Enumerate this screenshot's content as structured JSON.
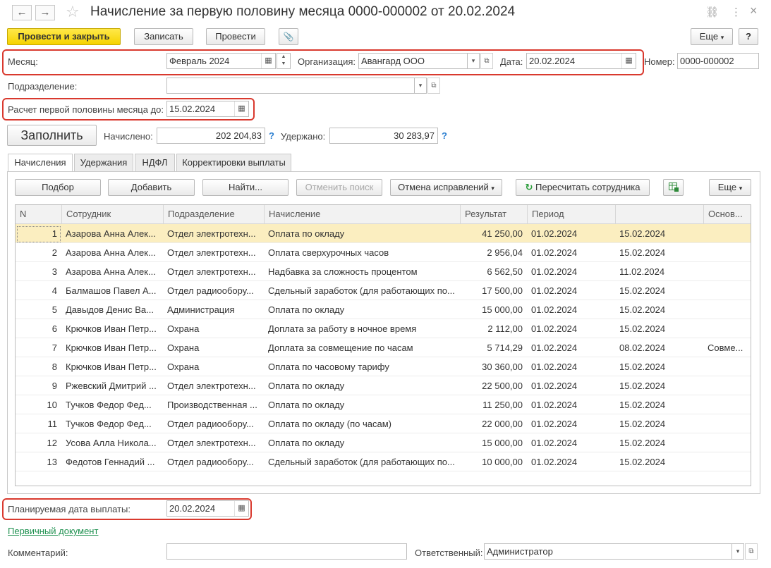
{
  "window": {
    "title": "Начисление за первую половину месяца 0000-000002 от 20.02.2024",
    "back_glyph": "←",
    "forward_glyph": "→",
    "star_glyph": "☆",
    "link_glyph": "⛓",
    "more_glyph": "⋮",
    "close_glyph": "×"
  },
  "toolbar": {
    "post_and_close": "Провести и закрыть",
    "save": "Записать",
    "post": "Провести",
    "attach_glyph": "📎",
    "more": "Еще",
    "help": "?"
  },
  "header": {
    "month_label": "Месяц:",
    "month_value": "Февраль 2024",
    "org_label": "Организация:",
    "org_value": "Авангард ООО",
    "date_label": "Дата:",
    "date_value": "20.02.2024",
    "number_label": "Номер:",
    "number_value": "0000-000002",
    "subdivision_label": "Подразделение:",
    "subdivision_value": "",
    "first_half_label": "Расчет первой половины месяца до:",
    "first_half_value": "15.02.2024"
  },
  "totals": {
    "fill_button": "Заполнить",
    "accrued_label": "Начислено:",
    "accrued_value": "202 204,83",
    "withheld_label": "Удержано:",
    "withheld_value": "30 283,97",
    "help": "?"
  },
  "tabs": [
    "Начисления",
    "Удержания",
    "НДФЛ",
    "Корректировки выплаты"
  ],
  "table_toolbar": {
    "select": "Подбор",
    "add": "Добавить",
    "find": "Найти...",
    "cancel_search": "Отменить поиск",
    "cancel_corrections": "Отмена исправлений",
    "recalc_employee": "Пересчитать сотрудника",
    "more": "Еще"
  },
  "table": {
    "columns": [
      "N",
      "Сотрудник",
      "Подразделение",
      "Начисление",
      "Результат",
      "Период",
      "",
      "Основ..."
    ],
    "rows": [
      [
        "1",
        "Азарова Анна Алек...",
        "Отдел электротехн...",
        "Оплата по окладу",
        "41 250,00",
        "01.02.2024",
        "15.02.2024",
        ""
      ],
      [
        "2",
        "Азарова Анна Алек...",
        "Отдел электротехн...",
        "Оплата сверхурочных часов",
        "2 956,04",
        "01.02.2024",
        "15.02.2024",
        ""
      ],
      [
        "3",
        "Азарова Анна Алек...",
        "Отдел электротехн...",
        "Надбавка за сложность процентом",
        "6 562,50",
        "01.02.2024",
        "11.02.2024",
        ""
      ],
      [
        "4",
        "Балмашов Павел А...",
        "Отдел радиообору...",
        "Сдельный заработок (для работающих по...",
        "17 500,00",
        "01.02.2024",
        "15.02.2024",
        ""
      ],
      [
        "5",
        "Давыдов Денис Ва...",
        "Администрация",
        "Оплата по окладу",
        "15 000,00",
        "01.02.2024",
        "15.02.2024",
        ""
      ],
      [
        "6",
        "Крючков Иван Петр...",
        "Охрана",
        "Доплата за работу в ночное время",
        "2 112,00",
        "01.02.2024",
        "15.02.2024",
        ""
      ],
      [
        "7",
        "Крючков Иван Петр...",
        "Охрана",
        "Доплата за совмещение по часам",
        "5 714,29",
        "01.02.2024",
        "08.02.2024",
        "Совме..."
      ],
      [
        "8",
        "Крючков Иван Петр...",
        "Охрана",
        "Оплата по часовому тарифу",
        "30 360,00",
        "01.02.2024",
        "15.02.2024",
        ""
      ],
      [
        "9",
        "Ржевский Дмитрий ...",
        "Отдел электротехн...",
        "Оплата по окладу",
        "22 500,00",
        "01.02.2024",
        "15.02.2024",
        ""
      ],
      [
        "10",
        "Тучков Федор Фед...",
        "Производственная ...",
        "Оплата по окладу",
        "11 250,00",
        "01.02.2024",
        "15.02.2024",
        ""
      ],
      [
        "11",
        "Тучков Федор Фед...",
        "Отдел радиообору...",
        "Оплата по окладу (по часам)",
        "22 000,00",
        "01.02.2024",
        "15.02.2024",
        ""
      ],
      [
        "12",
        "Усова Алла Никола...",
        "Отдел электротехн...",
        "Оплата по окладу",
        "15 000,00",
        "01.02.2024",
        "15.02.2024",
        ""
      ],
      [
        "13",
        "Федотов Геннадий ...",
        "Отдел радиообору...",
        "Сдельный заработок (для работающих по...",
        "10 000,00",
        "01.02.2024",
        "15.02.2024",
        ""
      ]
    ]
  },
  "footer": {
    "planned_date_label": "Планируемая дата выплаты:",
    "planned_date_value": "20.02.2024",
    "primary_doc_link": "Первичный документ",
    "comment_label": "Комментарий:",
    "comment_value": "",
    "responsible_label": "Ответственный:",
    "responsible_value": "Администратор"
  },
  "colors": {
    "highlight_border": "#d9392e",
    "primary_button": "#f5d300",
    "selected_row": "#fbeec0",
    "link": "#1f9150",
    "help": "#2a7ed0"
  }
}
